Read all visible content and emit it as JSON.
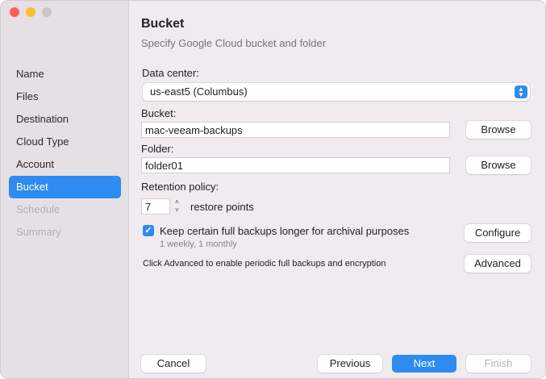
{
  "sidebar": {
    "items": [
      {
        "label": "Name"
      },
      {
        "label": "Files"
      },
      {
        "label": "Destination"
      },
      {
        "label": "Cloud Type"
      },
      {
        "label": "Account"
      },
      {
        "label": "Bucket"
      },
      {
        "label": "Schedule"
      },
      {
        "label": "Summary"
      }
    ]
  },
  "header": {
    "title": "Bucket",
    "subtitle": "Specify Google Cloud bucket and folder"
  },
  "form": {
    "datacenter_label": "Data center:",
    "datacenter_value": "us-east5 (Columbus)",
    "bucket_label": "Bucket:",
    "bucket_value": "mac-veeam-backups",
    "folder_label": "Folder:",
    "folder_value": "folder01",
    "browse_label": "Browse",
    "retention_label": "Retention policy:",
    "retention_value": "7",
    "retention_unit": "restore points",
    "keep_label": "Keep certain full backups longer for archival purposes",
    "keep_checked": true,
    "keep_detail": "1 weekly, 1 monthly",
    "configure_label": "Configure",
    "advanced_hint": "Click Advanced to enable periodic full backups and encryption",
    "advanced_label": "Advanced"
  },
  "footer": {
    "cancel": "Cancel",
    "previous": "Previous",
    "next": "Next",
    "finish": "Finish"
  },
  "colors": {
    "accent": "#2e8bf0"
  }
}
